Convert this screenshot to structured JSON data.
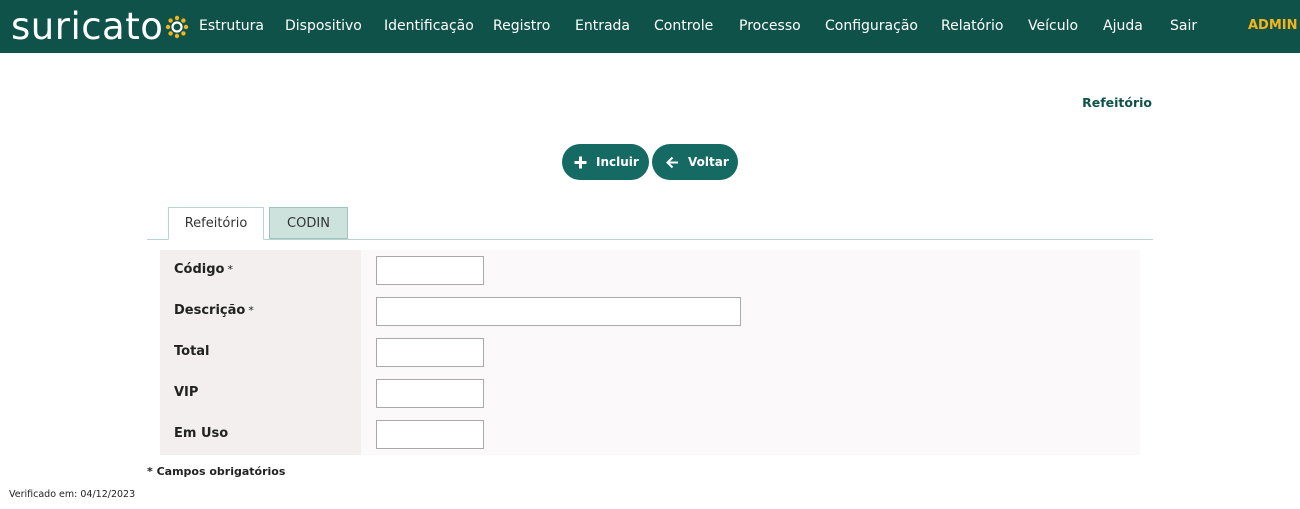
{
  "brand": {
    "logo_text": "suricato",
    "accent_color": "#f4b41a",
    "bar_color": "#0f5249"
  },
  "nav": {
    "items": [
      {
        "label": "Estrutura"
      },
      {
        "label": "Dispositivo"
      },
      {
        "label": "Identificação"
      },
      {
        "label": "Registro"
      },
      {
        "label": "Entrada"
      },
      {
        "label": "Controle"
      },
      {
        "label": "Processo"
      },
      {
        "label": "Configuração"
      },
      {
        "label": "Relatório"
      },
      {
        "label": "Veículo"
      },
      {
        "label": "Ajuda"
      },
      {
        "label": "Sair"
      }
    ],
    "user": "ADMIN"
  },
  "page": {
    "title": "Refeitório"
  },
  "actions": {
    "include_label": "Incluir",
    "include_icon": "plus-icon",
    "back_label": "Voltar",
    "back_icon": "arrow-left-icon"
  },
  "tabs": [
    {
      "label": "Refeitório",
      "active": true
    },
    {
      "label": "CODIN",
      "active": false
    }
  ],
  "form": {
    "fields": [
      {
        "label": "Código",
        "required": true,
        "required_mark": "*",
        "value": ""
      },
      {
        "label": "Descrição",
        "required": true,
        "required_mark": "*",
        "value": ""
      },
      {
        "label": "Total",
        "required": false,
        "value": ""
      },
      {
        "label": "VIP",
        "required": false,
        "value": ""
      },
      {
        "label": "Em Uso",
        "required": false,
        "value": ""
      }
    ]
  },
  "footer": {
    "required_note": "* Campos obrigatórios",
    "verified": "Verificado em: 04/12/2023"
  }
}
